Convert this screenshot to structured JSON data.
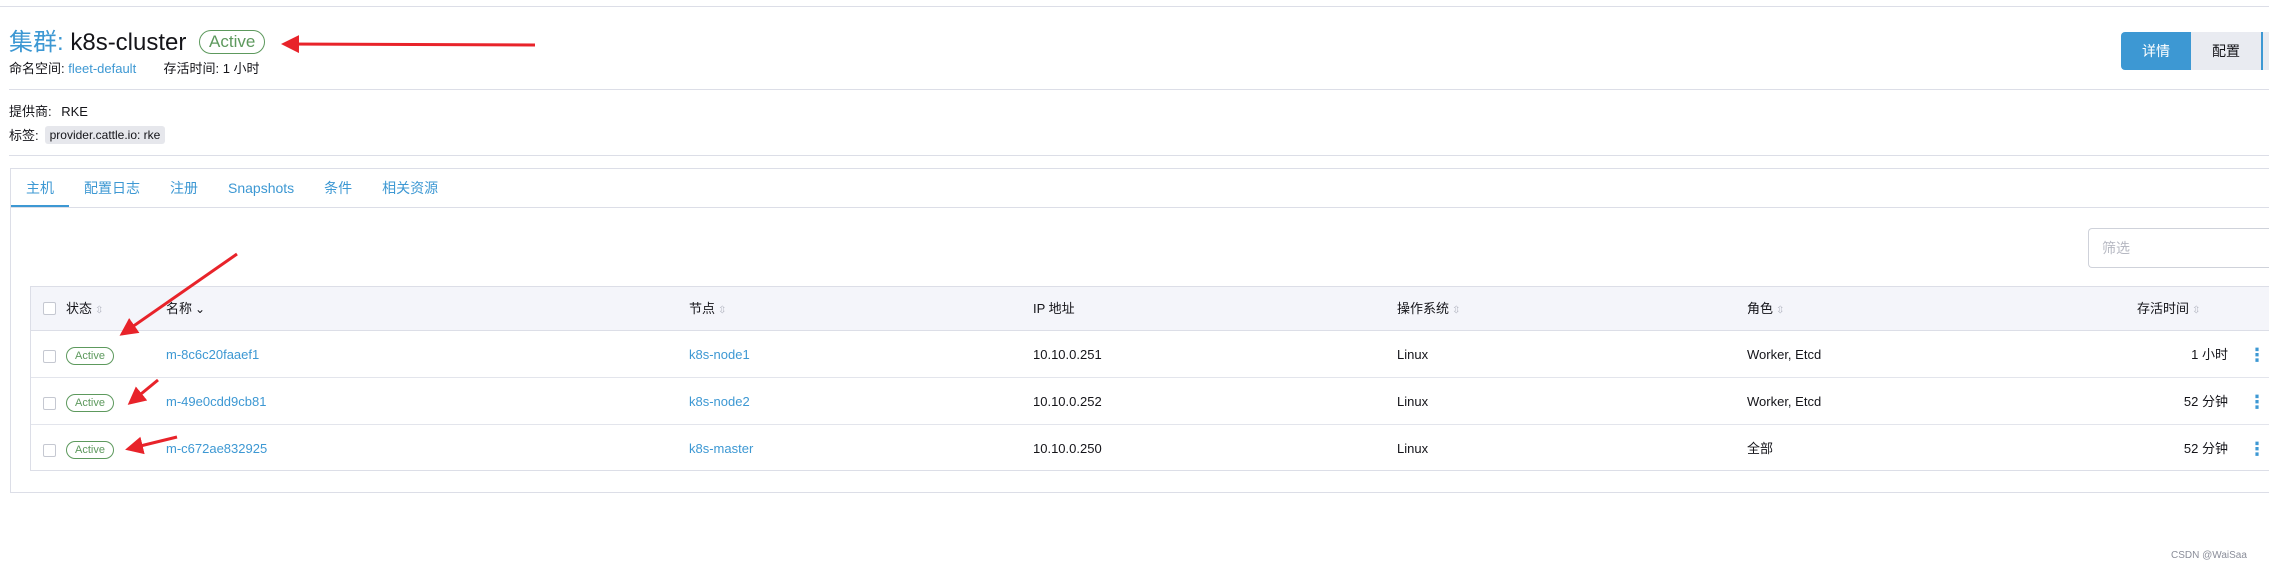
{
  "header": {
    "kind": "集群:",
    "name": "k8s-cluster",
    "status": "Active",
    "namespace_label": "命名空间:",
    "namespace": "fleet-default",
    "age_label": "存活时间:",
    "age": "1 小时"
  },
  "actions": {
    "detail": "详情",
    "config": "配置"
  },
  "info": {
    "provider_label": "提供商:",
    "provider": "RKE",
    "labels_label": "标签:",
    "label_tag": "provider.cattle.io: rke"
  },
  "tabs": [
    "主机",
    "配置日志",
    "注册",
    "Snapshots",
    "条件",
    "相关资源"
  ],
  "filter": {
    "placeholder": "筛选"
  },
  "table": {
    "columns": [
      "状态",
      "名称",
      "节点",
      "IP 地址",
      "操作系统",
      "角色",
      "存活时间"
    ],
    "rows": [
      {
        "state": "Active",
        "name": "m-8c6c20faaef1",
        "node": "k8s-node1",
        "ip": "10.10.0.251",
        "os": "Linux",
        "roles": "Worker, Etcd",
        "age": "1 小时"
      },
      {
        "state": "Active",
        "name": "m-49e0cdd9cb81",
        "node": "k8s-node2",
        "ip": "10.10.0.252",
        "os": "Linux",
        "roles": "Worker, Etcd",
        "age": "52 分钟"
      },
      {
        "state": "Active",
        "name": "m-c672ae832925",
        "node": "k8s-master",
        "ip": "10.10.0.250",
        "os": "Linux",
        "roles": "全部",
        "age": "52 分钟"
      }
    ]
  },
  "footer": {
    "watermark": "CSDN @WaiSaa"
  },
  "colors": {
    "accent": "#3d98d3",
    "active_green": "#5d995d",
    "annotation_red": "#e8232a"
  }
}
